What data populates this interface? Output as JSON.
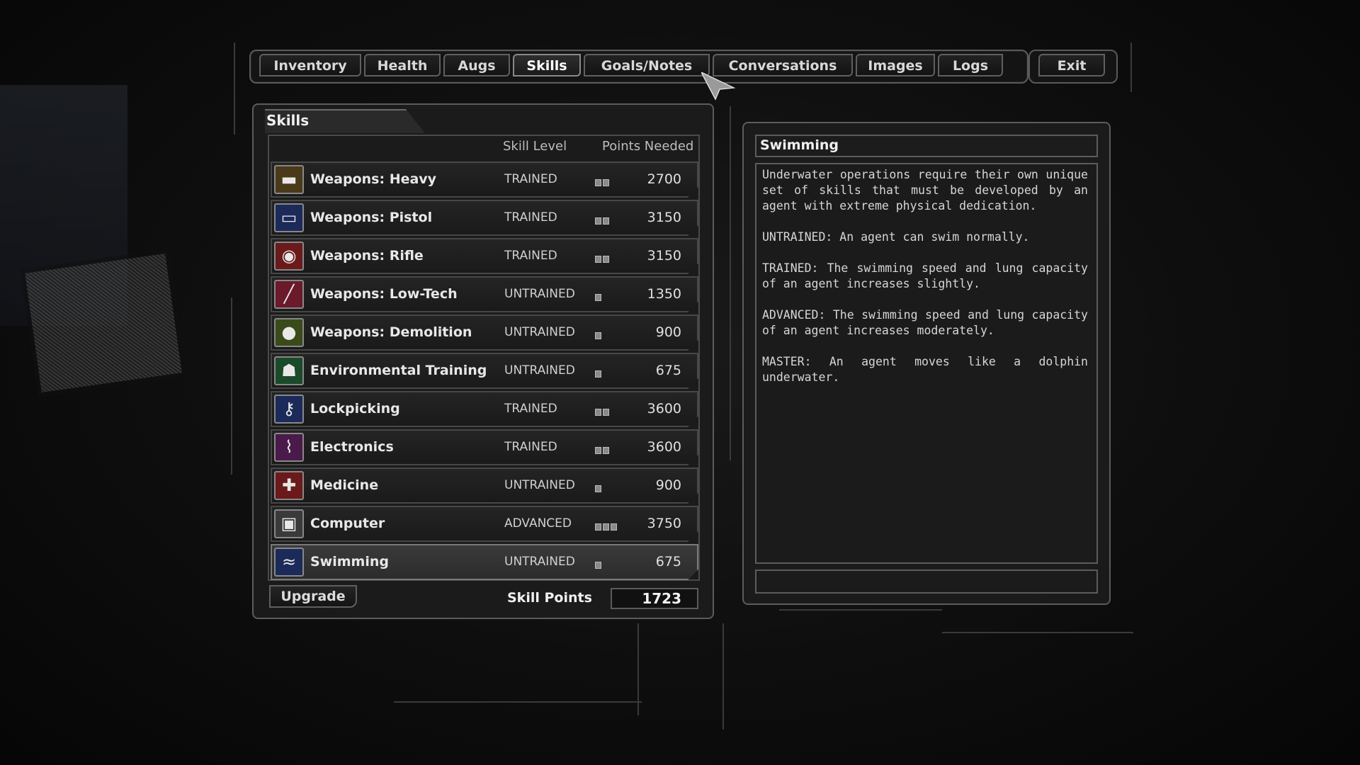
{
  "tabs": [
    {
      "label": "Inventory",
      "active": false
    },
    {
      "label": "Health",
      "active": false
    },
    {
      "label": "Augs",
      "active": false
    },
    {
      "label": "Skills",
      "active": true
    },
    {
      "label": "Goals/Notes",
      "active": false
    },
    {
      "label": "Conversations",
      "active": false
    },
    {
      "label": "Images",
      "active": false
    },
    {
      "label": "Logs",
      "active": false
    }
  ],
  "exit_label": "Exit",
  "skills_panel": {
    "title": "Skills",
    "col_level": "Skill Level",
    "col_points": "Points Needed",
    "rows": [
      {
        "name": "Weapons: Heavy",
        "level": "TRAINED",
        "rank": 2,
        "points": "2700",
        "icon": "heavy-weapon-icon"
      },
      {
        "name": "Weapons: Pistol",
        "level": "TRAINED",
        "rank": 2,
        "points": "3150",
        "icon": "pistol-icon"
      },
      {
        "name": "Weapons: Rifle",
        "level": "TRAINED",
        "rank": 2,
        "points": "3150",
        "icon": "rifle-icon"
      },
      {
        "name": "Weapons: Low-Tech",
        "level": "UNTRAINED",
        "rank": 1,
        "points": "1350",
        "icon": "low-tech-icon"
      },
      {
        "name": "Weapons: Demolition",
        "level": "UNTRAINED",
        "rank": 1,
        "points": "900",
        "icon": "demolition-icon"
      },
      {
        "name": "Environmental Training",
        "level": "UNTRAINED",
        "rank": 1,
        "points": "675",
        "icon": "environmental-icon"
      },
      {
        "name": "Lockpicking",
        "level": "TRAINED",
        "rank": 2,
        "points": "3600",
        "icon": "lockpick-icon"
      },
      {
        "name": "Electronics",
        "level": "TRAINED",
        "rank": 2,
        "points": "3600",
        "icon": "electronics-icon"
      },
      {
        "name": "Medicine",
        "level": "UNTRAINED",
        "rank": 1,
        "points": "900",
        "icon": "medicine-icon"
      },
      {
        "name": "Computer",
        "level": "ADVANCED",
        "rank": 3,
        "points": "3750",
        "icon": "computer-icon"
      },
      {
        "name": "Swimming",
        "level": "UNTRAINED",
        "rank": 1,
        "points": "675",
        "icon": "swimming-icon"
      }
    ],
    "selected_index": 10,
    "upgrade_label": "Upgrade",
    "skill_points_label": "Skill Points",
    "skill_points_value": "1723"
  },
  "description_panel": {
    "title": "Swimming",
    "paragraphs": [
      "Underwater operations require their own unique set of skills that must be developed by an agent with extreme physical dedication.",
      "UNTRAINED: An agent can swim normally.",
      "TRAINED: The swimming speed and lung capacity of an agent increases slightly.",
      "ADVANCED:  The swimming speed and lung capacity of an agent increases moderately.",
      "MASTER: An agent moves like a dolphin underwater."
    ]
  }
}
